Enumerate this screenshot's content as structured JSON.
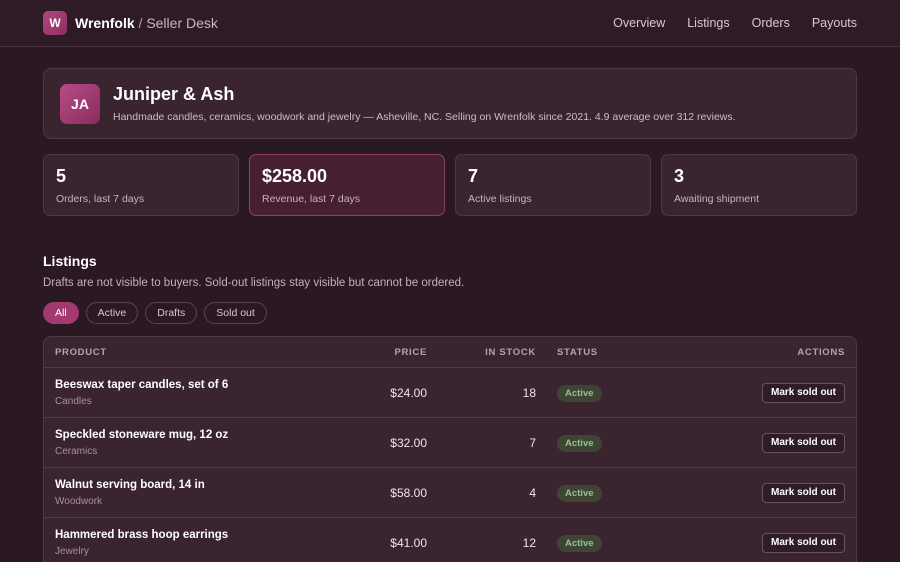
{
  "header": {
    "logo_letter": "W",
    "brand_name": "Wrenfolk",
    "brand_sep": " / ",
    "brand_sub": "Seller Desk",
    "nav": [
      "Overview",
      "Listings",
      "Orders",
      "Payouts"
    ]
  },
  "shop": {
    "initials": "JA",
    "name": "Juniper & Ash",
    "description": "Handmade candles, ceramics, woodwork and jewelry — Asheville, NC. Selling on Wrenfolk since 2021. 4.9 average over 312 reviews."
  },
  "stats": [
    {
      "value": "5",
      "label": "Orders, last 7 days"
    },
    {
      "value": "$258.00",
      "label": "Revenue, last 7 days"
    },
    {
      "value": "7",
      "label": "Active listings"
    },
    {
      "value": "3",
      "label": "Awaiting shipment"
    }
  ],
  "listings": {
    "title": "Listings",
    "description": "Drafts are not visible to buyers. Sold-out listings stay visible but cannot be ordered.",
    "filters": [
      "All",
      "Active",
      "Drafts",
      "Sold out"
    ],
    "columns": {
      "product": "PRODUCT",
      "price": "PRICE",
      "stock": "IN STOCK",
      "status": "STATUS",
      "actions": "ACTIONS"
    },
    "rows": [
      {
        "name": "Beeswax taper candles, set of 6",
        "category": "Candles",
        "price": "$24.00",
        "stock": "18",
        "status": "Active",
        "action": "Mark sold out"
      },
      {
        "name": "Speckled stoneware mug, 12 oz",
        "category": "Ceramics",
        "price": "$32.00",
        "stock": "7",
        "status": "Active",
        "action": "Mark sold out"
      },
      {
        "name": "Walnut serving board, 14 in",
        "category": "Woodwork",
        "price": "$58.00",
        "stock": "4",
        "status": "Active",
        "action": "Mark sold out"
      },
      {
        "name": "Hammered brass hoop earrings",
        "category": "Jewelry",
        "price": "$41.00",
        "stock": "12",
        "status": "Active",
        "action": "Mark sold out"
      }
    ]
  },
  "colors": {
    "accent": "#a2396f",
    "active_badge": "#8fc48c",
    "background": "#2a1822"
  }
}
